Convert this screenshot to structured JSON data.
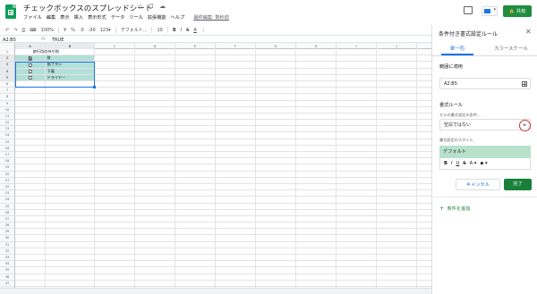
{
  "header": {
    "doc_title": "チェックボックスのスプレッドシート",
    "star_icon": "☆",
    "move_icon": "⊡",
    "cloud_icon": "☁",
    "menus": [
      "ファイル",
      "編集",
      "表示",
      "挿入",
      "表示形式",
      "データ",
      "ツール",
      "拡張機能",
      "ヘルプ"
    ],
    "last_edit": "最終編集: 数秒前",
    "share_label": "共有",
    "lock_icon": "🔒"
  },
  "toolbar": {
    "undo": "↶",
    "redo": "↷",
    "print": "⎙",
    "paint": "⌨",
    "zoom": "100%",
    "currency": "¥",
    "percent": "%",
    "decimal_less": ".0",
    "decimal_more": ".00",
    "number_format": "123▾",
    "font": "デフォルト...",
    "font_size": "10",
    "bold": "B",
    "italic": "I",
    "strike": "S",
    "text_color": "A",
    "more": "⋮"
  },
  "formula_bar": {
    "name_box": "A2:B5",
    "fx": "fx",
    "value": "TRUE"
  },
  "grid": {
    "columns": [
      "A",
      "B",
      "C",
      "D",
      "E",
      "F",
      "G",
      "H",
      "I",
      "J",
      "K"
    ],
    "rows": [
      {
        "n": "1",
        "a": "",
        "b": "旅行用の持ち物"
      },
      {
        "n": "2",
        "checked": true,
        "b": "財"
      },
      {
        "n": "3",
        "checked": false,
        "b": "歯ブラシ"
      },
      {
        "n": "4",
        "checked": false,
        "b": "下着"
      },
      {
        "n": "5",
        "checked": false,
        "b": "ドライヤー"
      },
      {
        "n": "6"
      },
      {
        "n": "7"
      },
      {
        "n": "8"
      },
      {
        "n": "9"
      },
      {
        "n": "10"
      },
      {
        "n": "11"
      },
      {
        "n": "12"
      },
      {
        "n": "13"
      },
      {
        "n": "14"
      },
      {
        "n": "15"
      },
      {
        "n": "16"
      },
      {
        "n": "17"
      },
      {
        "n": "18"
      },
      {
        "n": "19"
      },
      {
        "n": "20"
      },
      {
        "n": "21"
      },
      {
        "n": "22"
      },
      {
        "n": "23"
      },
      {
        "n": "24"
      },
      {
        "n": "25"
      },
      {
        "n": "26"
      },
      {
        "n": "27"
      },
      {
        "n": "28"
      },
      {
        "n": "29"
      },
      {
        "n": "30"
      },
      {
        "n": "31"
      },
      {
        "n": "32"
      },
      {
        "n": "33"
      },
      {
        "n": "34"
      },
      {
        "n": "35"
      },
      {
        "n": "36"
      },
      {
        "n": "37"
      },
      {
        "n": "38"
      }
    ],
    "highlight_color": "#b3dfd9"
  },
  "panel": {
    "title": "条件付き書式設定ルール",
    "close_icon": "✕",
    "tab_single": "単一色",
    "tab_scale": "カラースケール",
    "range_label": "範囲に適用",
    "range_value": "A2:B5",
    "format_rule_label": "書式ルール",
    "condition_label": "セルの書式設定の条件...",
    "condition_value": "空白ではない",
    "style_label": "書式設定のスタイル",
    "style_preview": "デフォルト",
    "style_tools": [
      "B",
      "I",
      "U",
      "S",
      "A ▾",
      "◆ ▾"
    ],
    "cancel": "キャンセル",
    "done": "完了",
    "add_rule": "条件を追加",
    "plus_icon": "+",
    "accent": "#1a73e8",
    "done_color": "#188038",
    "preview_color": "#b7e1cd"
  }
}
